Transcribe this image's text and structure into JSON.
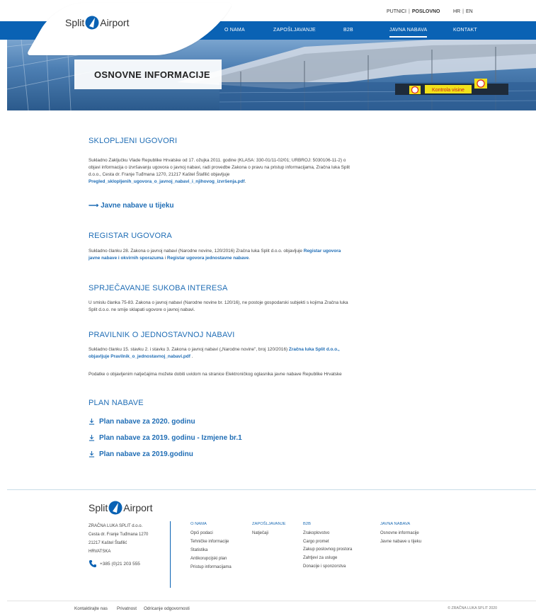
{
  "header": {
    "utility": {
      "putnici": "PUTNICI",
      "separator": "|",
      "poslovno": "POSLOVNO",
      "lang_hr": "HR",
      "lang_sep": "|",
      "lang_en": "EN"
    },
    "logo": {
      "left": "Split",
      "right": "Airport"
    },
    "nav": [
      {
        "label": "O NAMA"
      },
      {
        "label": "ZAPOŠLJAVANJE"
      },
      {
        "label": "B2B"
      },
      {
        "label": "JAVNA NABAVA",
        "active": true
      },
      {
        "label": "KONTAKT"
      }
    ]
  },
  "hero": {
    "title": "OSNOVNE INFORMACIJE",
    "sign_text": "Kontrola visine"
  },
  "sections": {
    "sklopljeni": {
      "title": "SKLOPLJENI UGOVORI",
      "text": "Sukladno Zaključku Vlade Republike Hrvatske od 17. ožujka 2011. godine (KLASA: 330-01/11-02/01; URBROJ: 5030106-11-2) o objavi informacija o izvršavanju ugovora o javnoj nabavi, radi provedbe Zakona o pravu na pristup informacijama, Zračna luka Split d.o.o., Cesta dr. Franje Tuđmana 1270, 21217 Kaštel Štafilić objavljuje ",
      "link": "Pregled_sklopljenih_ugovora_o_javnoj_nabavi_i_njihovog_izvršenja.pdf",
      "tail": "."
    },
    "u_tijeku": {
      "arrow": "⟶",
      "label": "Javne nabave u tijeku"
    },
    "registar": {
      "title": "REGISTAR UGOVORA",
      "text": "Sukladno članku 28. Zakona o javnoj nabavi (Narodne novine, 120/2016) Zračna luka Split d.o.o. objavljuje ",
      "link1": "Registar ugovora javne nabave i okvirnih sporazuma",
      "mid": "  i ",
      "link2": "Registar ugovora jednostavne nabave",
      "tail": "."
    },
    "sukob": {
      "title": "SPRJEČAVANJE SUKOBA INTERESA",
      "text": "U smislu članka 75-83. Zakona o javnoj nabavi (Narodne novine br. 120/16), ne postoje gospodarski subjekti s kojima Zračna luka Split d.o.o. ne smije sklapati ugovore o javnoj nabavi."
    },
    "pravilnik": {
      "title": "PRAVILNIK O JEDNOSTAVNOJ NABAVI",
      "text": "Sukladno članku 15. stavku 2. i stavku 3. Zakona o javnoj nabavi („Narodne novine\", broj 120/2016) ",
      "link": "Zračna luka Split d.o.o., objavljuje Pravilnik_o_jednostavnoj_nabavi.pdf",
      "tail": " .",
      "text2": "Podatke o objavljenim natječajima možete dobiti uvidom na stranice Elektroničkog oglasnika javne nabave Republike Hrvatske"
    },
    "plan": {
      "title": "PLAN NABAVE",
      "items": [
        {
          "label": "Plan nabave za 2020. godinu"
        },
        {
          "label": "Plan nabave za 2019. godinu - Izmjene br.1"
        },
        {
          "label": "Plan nabave za 2019.godinu"
        }
      ]
    }
  },
  "footer": {
    "logo": {
      "left": "Split",
      "right": "Airport"
    },
    "address": [
      "ZRAČNA LUKA SPLIT d.o.o.",
      "Cesta dr. Franje Tuđmana 1270",
      "21217 Kaštel Štafilić",
      "HRVATSKA"
    ],
    "phone": "+385 (0)21 203 555",
    "columns": [
      {
        "heading": "O NAMA",
        "items": [
          "Opći podaci",
          "Tehničke informacije",
          "Statistika",
          "Antikorupcijski plan",
          "Pristup informacijama"
        ]
      },
      {
        "heading": "ZAPOŠLJAVANJE",
        "items": [
          "Natječaji"
        ]
      },
      {
        "heading": "B2B",
        "items": [
          "Zrakoplovstvo",
          "Cargo promet",
          "Zakup poslovnog prostora",
          "Zahtjevi za usluge",
          "Donacije i sponzorstva"
        ]
      },
      {
        "heading": "JAVNA NABAVA",
        "items": [
          "Osnovne informacije",
          "Javne nabave u tijeku"
        ]
      }
    ],
    "bottom_links": [
      "Kontaktirajte nas",
      "Privatnost",
      "Odricanje odgovornosti"
    ],
    "copyright": "© ZRAČNA LUKA SPLIT 2020"
  },
  "colors": {
    "brand_blue": "#0a62b4",
    "link_blue": "#1f6db5"
  }
}
